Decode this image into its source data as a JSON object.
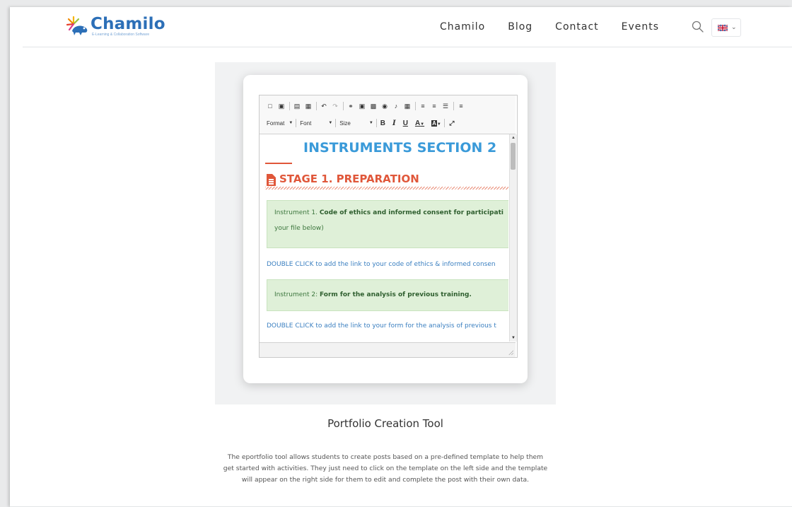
{
  "header": {
    "logo": {
      "name": "Chamilo",
      "tagline": "E-Learning & Collaboration Software"
    },
    "nav": [
      {
        "label": "Chamilo"
      },
      {
        "label": "Blog"
      },
      {
        "label": "Contact"
      },
      {
        "label": "Events"
      }
    ],
    "search_icon": "search-icon",
    "language": {
      "icon": "uk-flag-icon"
    }
  },
  "editor": {
    "toolbar": {
      "format_label": "Format",
      "font_label": "Font",
      "size_label": "Size",
      "bold_label": "B",
      "italic_label": "I",
      "underline_label": "U",
      "text_color_label": "A",
      "bg_color_label": "A"
    },
    "content": {
      "title": "INSTRUMENTS SECTION 2",
      "stage_heading": "STAGE 1. PREPARATION",
      "instrument1_prefix": "Instrument 1. ",
      "instrument1_bold": "Code of ethics and informed consent for participati",
      "instrument1_cont": "your file below)",
      "link1": "DOUBLE CLICK to add the link to your code of ethics & informed consen",
      "instrument2_prefix": "Instrument 2: ",
      "instrument2_bold": "Form for the analysis of previous training.",
      "link2": "DOUBLE CLICK to add the link to your form for the analysis of previous t"
    }
  },
  "caption": {
    "title": "Portfolio Creation Tool",
    "line1": "The eportfolio tool allows students to create posts based on a pre-defined template to help them",
    "line2": "get started with activities. They just need to click on the template on the left side and the template",
    "line3": "will appear on the right side for them to edit and complete the post with their own data."
  },
  "colors": {
    "brand_blue": "#2c6fb7",
    "title_blue": "#3a9ad9",
    "stage_orange": "#e0573a",
    "alert_green_bg": "#dff0d8",
    "alert_green_text": "#3c763d",
    "link_blue": "#3a7fc0"
  }
}
